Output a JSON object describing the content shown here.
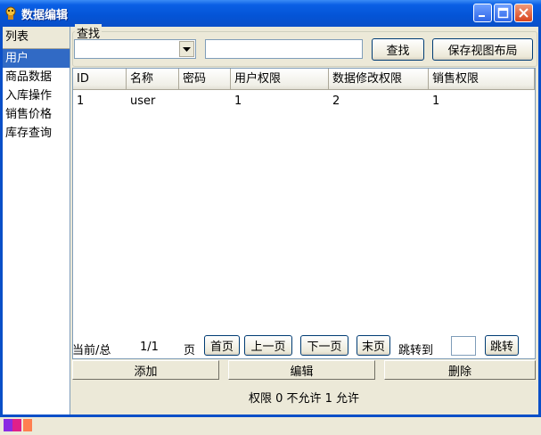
{
  "window": {
    "title": "数据编辑",
    "accent": "#0454d6",
    "selection": "#316ac5"
  },
  "sidebar": {
    "header": "列表",
    "items": [
      {
        "label": "用户",
        "selected": true
      },
      {
        "label": "商品数据",
        "selected": false
      },
      {
        "label": "入库操作",
        "selected": false
      },
      {
        "label": "销售价格",
        "selected": false
      },
      {
        "label": "库存查询",
        "selected": false
      }
    ]
  },
  "search": {
    "legend": "查找",
    "combo_value": "",
    "input_value": "",
    "search_button": "查找",
    "save_layout_button": "保存视图布局"
  },
  "table": {
    "columns": [
      "ID",
      "名称",
      "密码",
      "用户权限",
      "数据修改权限",
      "销售权限"
    ],
    "rows": [
      [
        "1",
        "user",
        "",
        "1",
        "2",
        "1"
      ]
    ]
  },
  "pager": {
    "current_total_label": "当前/总",
    "page_value": "1/1",
    "page_unit": "页",
    "first": "首页",
    "prev": "上一页",
    "next": "下一页",
    "last": "末页",
    "jump_label": "跳转到",
    "jump_value": "",
    "jump_button": "跳转"
  },
  "actions": {
    "add": "添加",
    "edit": "编辑",
    "delete": "删除"
  },
  "status": {
    "text": "权限 0 不允许 1 允许"
  }
}
